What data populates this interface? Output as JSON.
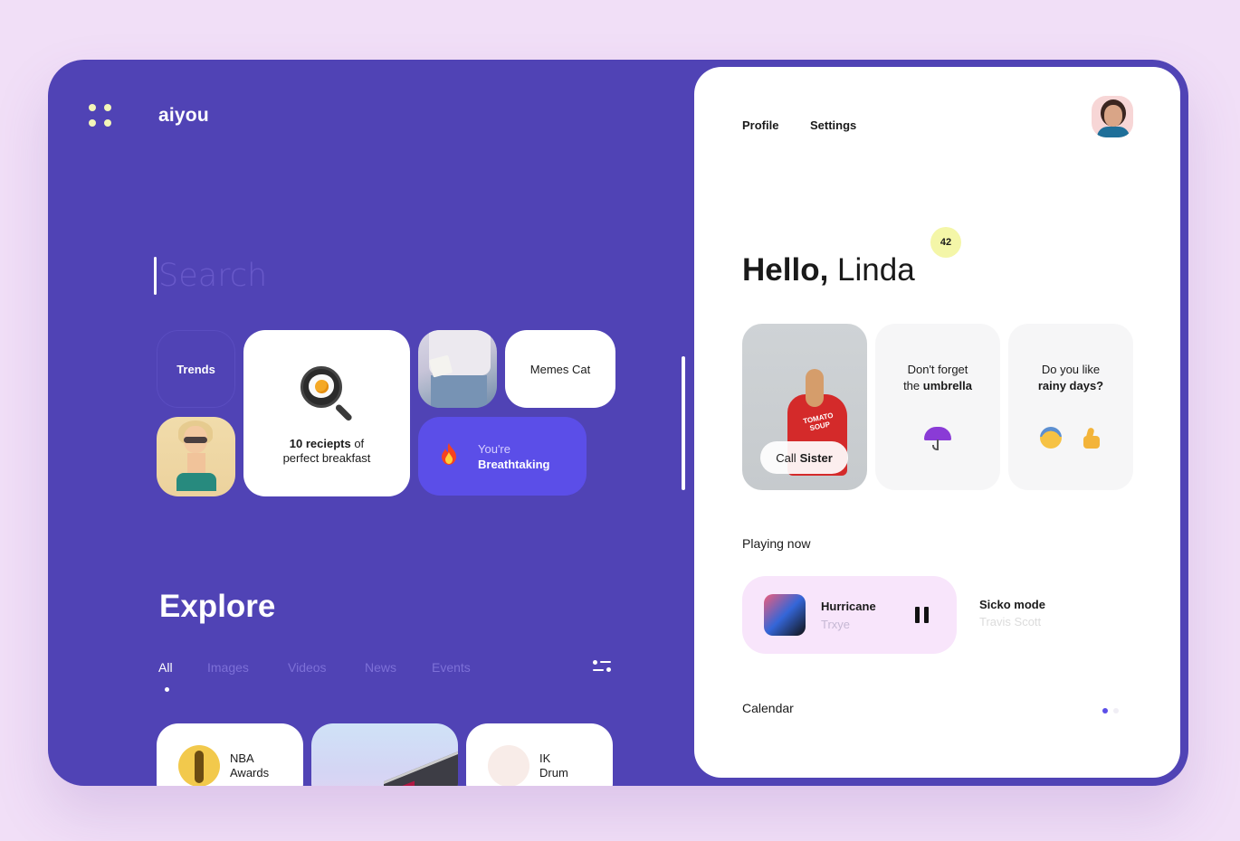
{
  "app": {
    "brand": "aiyou",
    "menu_icon": "grid-dots-icon"
  },
  "search": {
    "placeholder": "Search",
    "value": ""
  },
  "tiles": {
    "trends": "Trends",
    "breakfast": {
      "bold": "10 reciepts",
      "rest1": " of",
      "line2": "perfect breakfast",
      "icon": "frying-pan-egg-icon"
    },
    "memes": "Memes Cat",
    "breathtaking": {
      "line1": "You're",
      "line2": "Breathtaking",
      "icon": "fire-icon"
    }
  },
  "explore": {
    "title": "Explore",
    "tabs": [
      {
        "label": "All",
        "active": true
      },
      {
        "label": "Images",
        "active": false
      },
      {
        "label": "Videos",
        "active": false
      },
      {
        "label": "News",
        "active": false
      },
      {
        "label": "Events",
        "active": false
      }
    ],
    "filter_icon": "sliders-icon",
    "cards": [
      {
        "line1": "NBA",
        "line2": "Awards"
      },
      {
        "line1": "",
        "line2": ""
      },
      {
        "line1": "IK",
        "line2": "Drum"
      }
    ]
  },
  "panel": {
    "nav": [
      "Profile",
      "Settings"
    ],
    "notification_count": "42",
    "greeting": {
      "bold": "Hello,",
      "name": " Linda"
    },
    "cards": {
      "call": {
        "word1": "Call",
        "word2": "Sister"
      },
      "umbrella": {
        "line1": "Don't forget",
        "line2_pre": "the ",
        "line2_bold": "umbrella"
      },
      "rainy": {
        "line1": "Do you like",
        "line2_bold": "rainy days?"
      }
    },
    "playing_now": {
      "label": "Playing now",
      "current": {
        "title": "Hurricane",
        "artist": "Trxye",
        "state": "playing"
      },
      "next": {
        "title": "Sicko mode",
        "artist": "Travis Scott"
      }
    },
    "calendar": {
      "label": "Calendar",
      "pages": 2,
      "active_page": 1
    }
  },
  "colors": {
    "frame_bg": "#5043b5",
    "page_bg": "#f1dff7",
    "accent": "#5b4ee8",
    "badge": "#f4f6a8",
    "player_bg": "#f8e5fb",
    "logo_dots": "#f3f6b8"
  }
}
